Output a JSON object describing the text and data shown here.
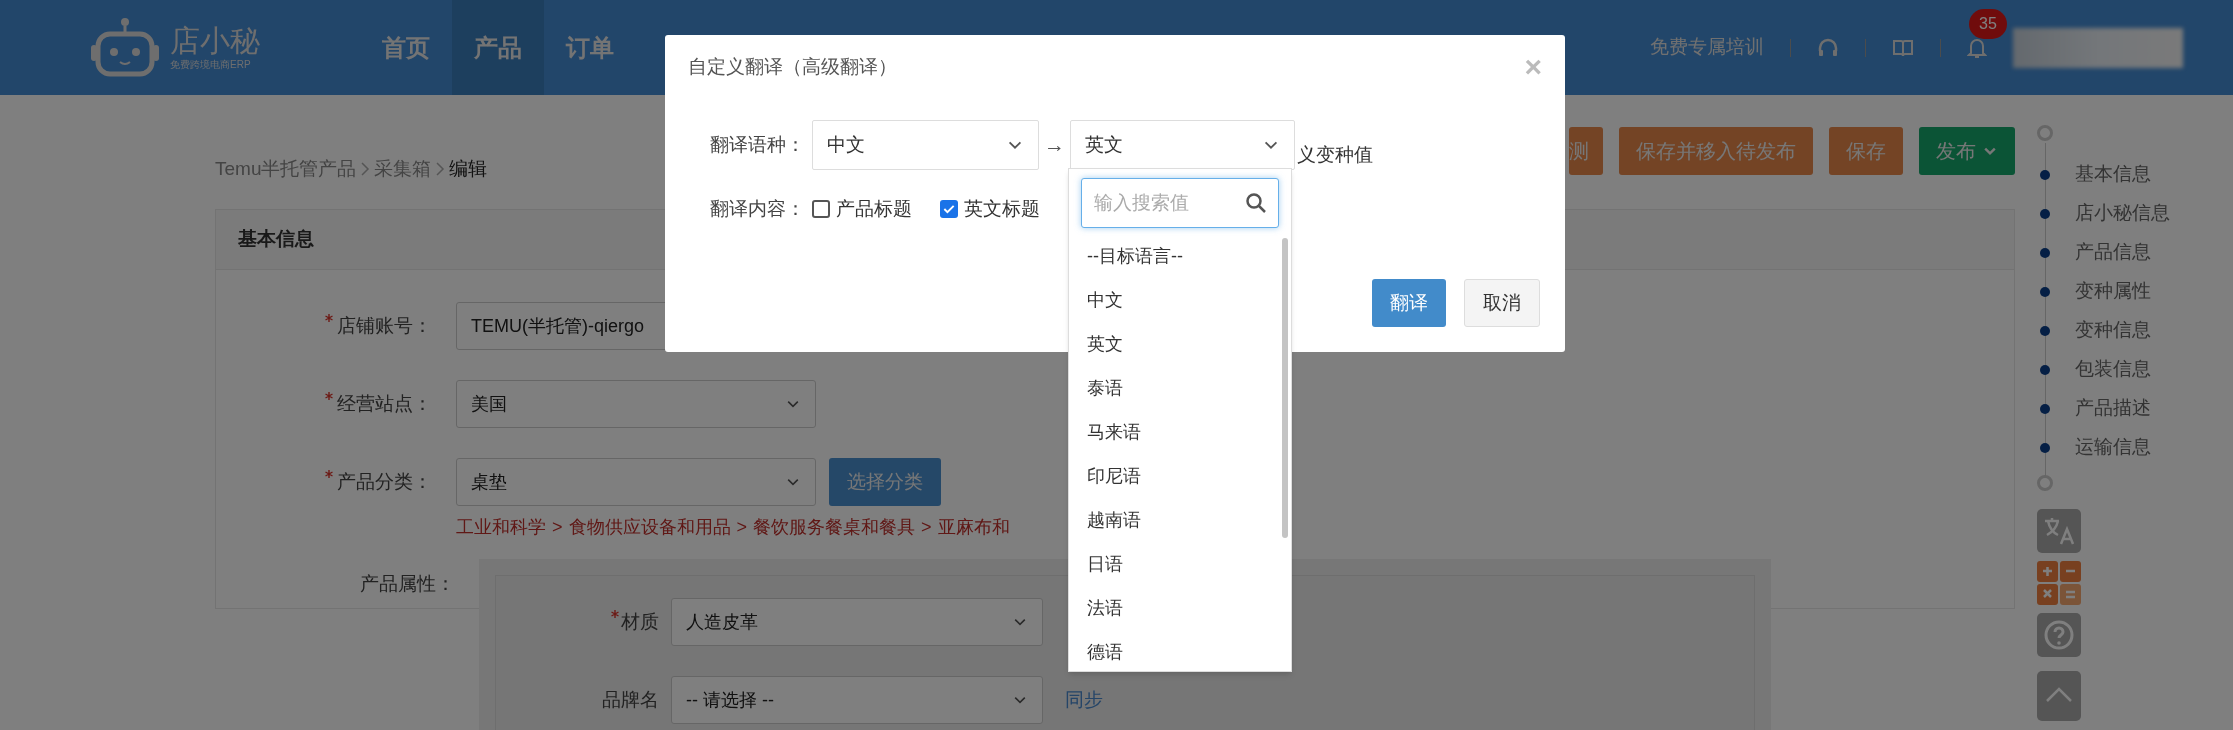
{
  "header": {
    "logo": {
      "name": "店小秘",
      "tagline": "免费跨境电商ERP"
    },
    "nav": [
      {
        "label": "首页",
        "selected": false
      },
      {
        "label": "产品",
        "selected": true
      },
      {
        "label": "订单",
        "selected": false
      }
    ],
    "training_link": "免费专属培训",
    "notification_count": "35"
  },
  "breadcrumb": [
    "Temu半托管产品",
    "采集箱",
    "编辑"
  ],
  "actions": [
    {
      "label": "测",
      "kind": "orange"
    },
    {
      "label": "保存并移入待发布",
      "kind": "orange"
    },
    {
      "label": "保存",
      "kind": "orange"
    },
    {
      "label": "发布",
      "kind": "green"
    }
  ],
  "section_nav": [
    "基本信息",
    "店小秘信息",
    "产品信息",
    "变种属性",
    "变种信息",
    "包装信息",
    "产品描述",
    "运输信息"
  ],
  "card": {
    "title": "基本信息",
    "fields": [
      {
        "label": "店铺账号：",
        "required": true,
        "kind": "input",
        "value": "TEMU(半托管)-qiergo"
      },
      {
        "label": "经营站点：",
        "required": true,
        "kind": "select",
        "value": "美国"
      },
      {
        "label": "产品分类：",
        "required": true,
        "kind": "select",
        "value": "桌垫",
        "button": "选择分类"
      }
    ],
    "category_path": [
      "工业和科学",
      "食物供应设备和用品",
      "餐饮服务餐桌和餐具",
      "亚麻布和"
    ],
    "path_separator": ">",
    "attributes_label": "产品属性：",
    "attributes": [
      {
        "label": "材质",
        "required": true,
        "value": "人造皮革"
      },
      {
        "label": "品牌名",
        "required": false,
        "value": "-- 请选择 --",
        "link": "同步"
      }
    ]
  },
  "dialog": {
    "title": "自定义翻译（高级翻译）",
    "close": "×",
    "language_label": "翻译语种：",
    "source": "中文",
    "arrow": "→",
    "target": "英文",
    "content_label": "翻译内容：",
    "options": [
      {
        "label": "产品标题",
        "checked": false
      },
      {
        "label": "英文标题",
        "checked": true
      }
    ],
    "content_tail": "义变种值",
    "buttons": [
      {
        "label": "翻译",
        "kind": "primary"
      },
      {
        "label": "取消",
        "kind": "default"
      }
    ]
  },
  "dropdown": {
    "placeholder": "输入搜索值",
    "options": [
      "--目标语言--",
      "中文",
      "英文",
      "泰语",
      "马来语",
      "印尼语",
      "越南语",
      "日语",
      "法语",
      "德语"
    ]
  }
}
